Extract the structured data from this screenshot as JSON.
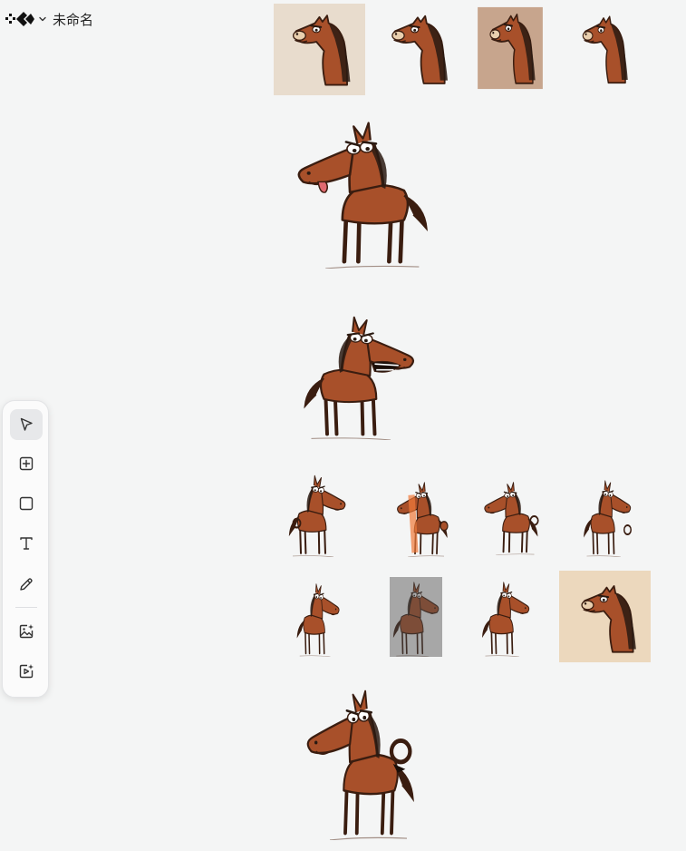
{
  "header": {
    "document_title": "未命名"
  },
  "toolbar": {
    "active_tool": "select",
    "tools": [
      {
        "name": "select-tool",
        "icon": "pointer-icon"
      },
      {
        "name": "frame-tool",
        "icon": "square-plus-icon"
      },
      {
        "name": "rectangle-tool",
        "icon": "square-icon"
      },
      {
        "name": "text-tool",
        "icon": "text-t-icon"
      },
      {
        "name": "pen-tool",
        "icon": "pencil-icon"
      },
      {
        "name": "image-generate-tool",
        "icon": "image-sparkle-icon"
      },
      {
        "name": "video-generate-tool",
        "icon": "video-sparkle-icon"
      }
    ]
  },
  "canvas": {
    "items": [
      {
        "name": "horse-head-portrait-1",
        "icon": "horse-head-icon",
        "background": "#e8dccd"
      },
      {
        "name": "horse-head-portrait-2",
        "icon": "horse-head-icon"
      },
      {
        "name": "horse-head-portrait-3",
        "icon": "horse-head-icon",
        "background": "#b88a6a"
      },
      {
        "name": "horse-head-portrait-4",
        "icon": "horse-head-icon"
      },
      {
        "name": "silly-horse-tongue",
        "icon": "horse-icon"
      },
      {
        "name": "angry-horse-shouting",
        "icon": "horse-icon"
      },
      {
        "name": "horse-ok-gesture-1",
        "icon": "horse-icon"
      },
      {
        "name": "horse-thumbs-up",
        "icon": "horse-icon"
      },
      {
        "name": "horse-ok-gesture-2",
        "icon": "horse-icon"
      },
      {
        "name": "horse-ok-gesture-3",
        "icon": "horse-icon"
      },
      {
        "name": "horse-standing-1",
        "icon": "horse-icon"
      },
      {
        "name": "horse-standing-dark",
        "icon": "horse-icon"
      },
      {
        "name": "horse-standing-2",
        "icon": "horse-icon"
      },
      {
        "name": "horse-sad-portrait",
        "icon": "horse-head-icon",
        "background": "#ecd8bd"
      },
      {
        "name": "horse-ok-sign-large",
        "icon": "horse-icon"
      }
    ],
    "colors": {
      "horse_body": "#a8502a",
      "horse_outline": "#3a1d10",
      "horse_mane": "#2a1a12",
      "canvas_background": "#f4f5f5"
    }
  }
}
